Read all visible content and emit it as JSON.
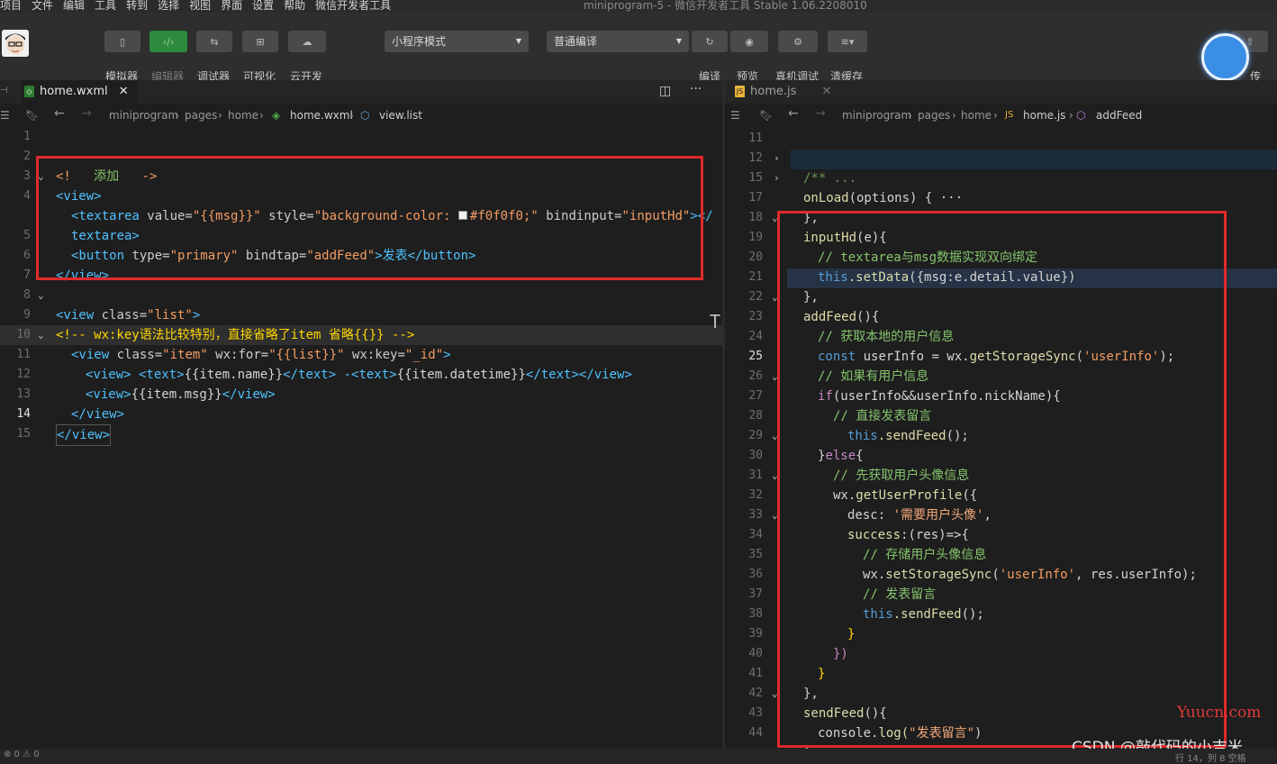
{
  "menubar": {
    "items": [
      "项目",
      "文件",
      "编辑",
      "工具",
      "转到",
      "选择",
      "视图",
      "界面",
      "设置",
      "帮助",
      "微信开发者工具"
    ],
    "title": "miniprogram-5 - 微信开发者工具 Stable 1.06.2208010"
  },
  "toolbar": {
    "simulator": "模拟器",
    "editor": "编辑器",
    "debugger": "调试器",
    "visual": "可视化",
    "cloud": "云开发",
    "mode": "小程序模式",
    "compile_mode": "普通编译",
    "compile": "编译",
    "preview": "预览",
    "remote_debug": "真机调试",
    "clear_cache": "清缓存",
    "upload": "传"
  },
  "left": {
    "tab": "home.wxml",
    "crumbs": [
      "miniprogram",
      "pages",
      "home",
      "home.wxml",
      "view.list"
    ],
    "lines": {
      "l2": [
        "<!",
        "添加",
        "->"
      ],
      "l3": [
        "<view>"
      ],
      "l4a": [
        "<textarea",
        " value=",
        "\"{{msg}}\"",
        " style=",
        "\"background-color: ",
        "#f0f0f0;\"",
        " bindinput=",
        "\"inputHd\"",
        "></"
      ],
      "l4b": [
        "textarea>"
      ],
      "l5": [
        "<button",
        " type=",
        "\"primary\"",
        " bindtap=",
        "\"addFeed\"",
        ">发表</button>"
      ],
      "l6": [
        "</view>"
      ],
      "l8": [
        "<view",
        " class=",
        "\"list\"",
        ">"
      ],
      "l9": [
        "<!-- wx:key语法比较特别，直接省略了item 省略{{}} -->"
      ],
      "l10": [
        "<view",
        " class=",
        "\"item\"",
        " wx:for=",
        "\"{{list}}\"",
        " wx:key=",
        "\"_id\"",
        ">"
      ],
      "l11": [
        "<view> <text>",
        "{{item.name}}",
        "</text> -<text>",
        "{{item.datetime}}",
        "</text></view>"
      ],
      "l12": [
        "<view>",
        "{{item.msg}}",
        "</view>"
      ],
      "l13": [
        "</view>"
      ],
      "l14": [
        "</view>"
      ]
    }
  },
  "right": {
    "tab": "home.js",
    "crumbs": [
      "miniprogram",
      "pages",
      "home",
      "home.js",
      "addFeed"
    ],
    "lines": {
      "l12": "/** ...",
      "l15a": "onLoad",
      "l15b": "(options) { ···",
      "l17": "},",
      "l18a": "inputHd",
      "l18b": "(e){",
      "l19": "// textarea与msg数据实现双向绑定",
      "l20a": "this",
      "l20b": ".setData",
      "l20c": "({msg:e.detail.value})",
      "l21": "},",
      "l22a": "addFeed",
      "l22b": "(){",
      "l23": "// 获取本地的用户信息",
      "l24a": "const",
      "l24b": " userInfo = wx.",
      "l24c": "getStorageSync",
      "l24d": "(",
      "l24e": "'userInfo'",
      "l24f": ");",
      "l25": "// 如果有用户信息",
      "l26a": "if",
      "l26b": "(userInfo&&userInfo.nickName){",
      "l27": "// 直接发表留言",
      "l28a": "this",
      "l28b": ".sendFeed",
      "l28c": "();",
      "l29a": "}",
      "l29b": "else",
      "l29c": "{",
      "l30": "// 先获取用户头像信息",
      "l31a": "wx.",
      "l31b": "getUserProfile",
      "l31c": "({",
      "l32a": "desc: ",
      "l32b": "'需要用户头像'",
      "l32c": ",",
      "l33a": "success",
      "l33b": ":(res)=>{",
      "l34": "// 存储用户头像信息",
      "l35a": "wx.",
      "l35b": "setStorageSync",
      "l35c": "(",
      "l35d": "'userInfo'",
      "l35e": ", res.userInfo);",
      "l36": "// 发表留言",
      "l37a": "this",
      "l37b": ".sendFeed",
      "l37c": "();",
      "l38": "}",
      "l39": "})",
      "l40": "}",
      "l41": "},",
      "l42a": "sendFeed",
      "l42b": "(){",
      "l43a": "console",
      "l43b": ".log(",
      "l43c": "\"发表留言\"",
      "l43d": ")",
      "l44": "},"
    }
  },
  "line_numbers_left": [
    "1",
    "2",
    "3",
    "4",
    "",
    "5",
    "6",
    "7",
    "8",
    "9",
    "10",
    "11",
    "12",
    "13",
    "14",
    "15"
  ],
  "line_numbers_right": [
    "11",
    "12",
    "15",
    "17",
    "18",
    "19",
    "20",
    "21",
    "22",
    "23",
    "24",
    "25",
    "26",
    "27",
    "28",
    "29",
    "30",
    "31",
    "32",
    "33",
    "34",
    "35",
    "36",
    "37",
    "38",
    "39",
    "40",
    "41",
    "42",
    "43",
    "44"
  ],
  "watermarks": {
    "yuucn": "Yuucn.com",
    "csdn": "CSDN @敲代码的小吉米"
  },
  "status": {
    "left": "⊗ 0 ⚠ 0",
    "right": "行 14，列 8    空格"
  }
}
